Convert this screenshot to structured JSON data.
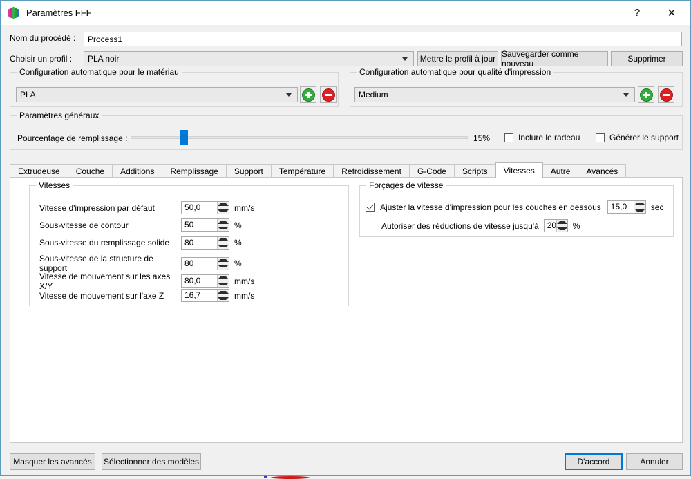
{
  "window": {
    "title": "Paramètres FFF",
    "app_icon": "simplify3d-bars-icon",
    "help_label": "?",
    "close_label": "✕"
  },
  "header": {
    "process_name_label": "Nom du procédé :",
    "process_name_value": "Process1",
    "profile_label": "Choisir un profil :",
    "profile_value": "PLA noir",
    "update_profile_button": "Mettre le profil à jour",
    "save_as_new_button": "Sauvegarder comme nouveau",
    "delete_button": "Supprimer"
  },
  "material_group": {
    "caption": "Configuration automatique pour le matériau",
    "value": "PLA",
    "add_button": "add-icon",
    "remove_button": "remove-icon"
  },
  "quality_group": {
    "caption": "Configuration automatique pour qualité d'impression",
    "value": "Medium",
    "add_button": "add-icon",
    "remove_button": "remove-icon"
  },
  "general_group": {
    "caption": "Paramètres généraux",
    "infill_label": "Pourcentage de remplissage :",
    "infill_value": "15%",
    "infill_percent": 15,
    "raft_checkbox_label": "Inclure le radeau",
    "raft_checked": false,
    "support_checkbox_label": "Générer le support",
    "support_checked": false
  },
  "tabs": [
    {
      "label": "Extrudeuse",
      "active": false
    },
    {
      "label": "Couche",
      "active": false
    },
    {
      "label": "Additions",
      "active": false
    },
    {
      "label": "Remplissage",
      "active": false
    },
    {
      "label": "Support",
      "active": false
    },
    {
      "label": "Température",
      "active": false
    },
    {
      "label": "Refroidissement",
      "active": false
    },
    {
      "label": "G-Code",
      "active": false
    },
    {
      "label": "Scripts",
      "active": false
    },
    {
      "label": "Vitesses",
      "active": true
    },
    {
      "label": "Autre",
      "active": false
    },
    {
      "label": "Avancés",
      "active": false
    }
  ],
  "speeds_group": {
    "caption": "Vitesses",
    "rows": [
      {
        "label": "Vitesse d'impression par défaut",
        "value": "50,0",
        "unit": "mm/s"
      },
      {
        "label": "Sous-vitesse de contour",
        "value": "50",
        "unit": "%"
      },
      {
        "label": "Sous-vitesse du remplissage solide",
        "value": "80",
        "unit": "%"
      },
      {
        "label": "Sous-vitesse de la structure de support",
        "value": "80",
        "unit": "%"
      },
      {
        "label": "Vitesse de mouvement sur les axes X/Y",
        "value": "80,0",
        "unit": "mm/s"
      },
      {
        "label": "Vitesse de mouvement sur l'axe Z",
        "value": "16,7",
        "unit": "mm/s"
      }
    ]
  },
  "overrides_group": {
    "caption": "Forçages de vitesse",
    "adjust_checkbox_label": "Ajuster la vitesse d'impression pour les couches en dessous",
    "adjust_checked": true,
    "adjust_value": "15,0",
    "adjust_unit": "sec",
    "reduction_label": "Autoriser des réductions de vitesse jusqu'à",
    "reduction_value": "20",
    "reduction_unit": "%"
  },
  "footer": {
    "hide_advanced_button": "Masquer les avancés",
    "select_models_button": "Sélectionner des modèles",
    "ok_button": "D'accord",
    "cancel_button": "Annuler"
  }
}
